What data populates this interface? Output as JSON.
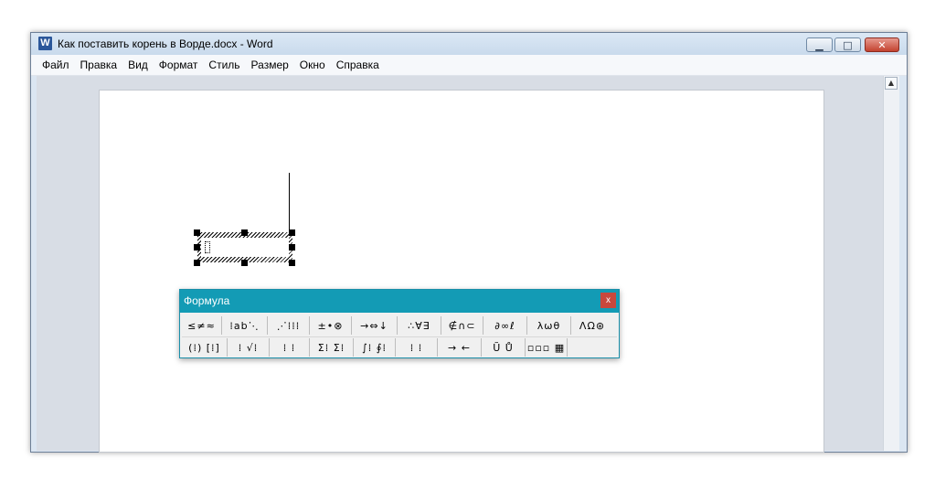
{
  "window": {
    "title": "Как поставить корень в Ворде.docx - Word",
    "app_icon": "W",
    "buttons": {
      "minimize": "▁",
      "maximize": "□",
      "close": "✕"
    }
  },
  "menu": [
    "Файл",
    "Правка",
    "Вид",
    "Формат",
    "Стиль",
    "Размер",
    "Окно",
    "Справка"
  ],
  "scrollbar": {
    "up_arrow": "▲"
  },
  "formula_toolbar": {
    "title": "Формула",
    "close": "x",
    "row1": [
      "≤≠≈",
      "⁞ab⋱",
      "⋰⁞⁞⁞",
      "±•⊗",
      "→⇔↓",
      "∴∀∃",
      "∉∩⊂",
      "∂∞ℓ",
      "λωθ",
      "ΛΩ⊛"
    ],
    "row2": [
      "(⁞) [⁞]",
      "⁞ √⁞",
      "⁞ ⁞",
      "Σ⁞ Σ⁞",
      "∫⁞ ∮⁞",
      "⁞ ⁞",
      "→ ←",
      "Ũ Ů",
      "▫▫▫ ▦"
    ]
  },
  "colors": {
    "formula_titlebar": "#139bb5",
    "close_button": "#c9483d",
    "word_icon": "#2b579a"
  }
}
